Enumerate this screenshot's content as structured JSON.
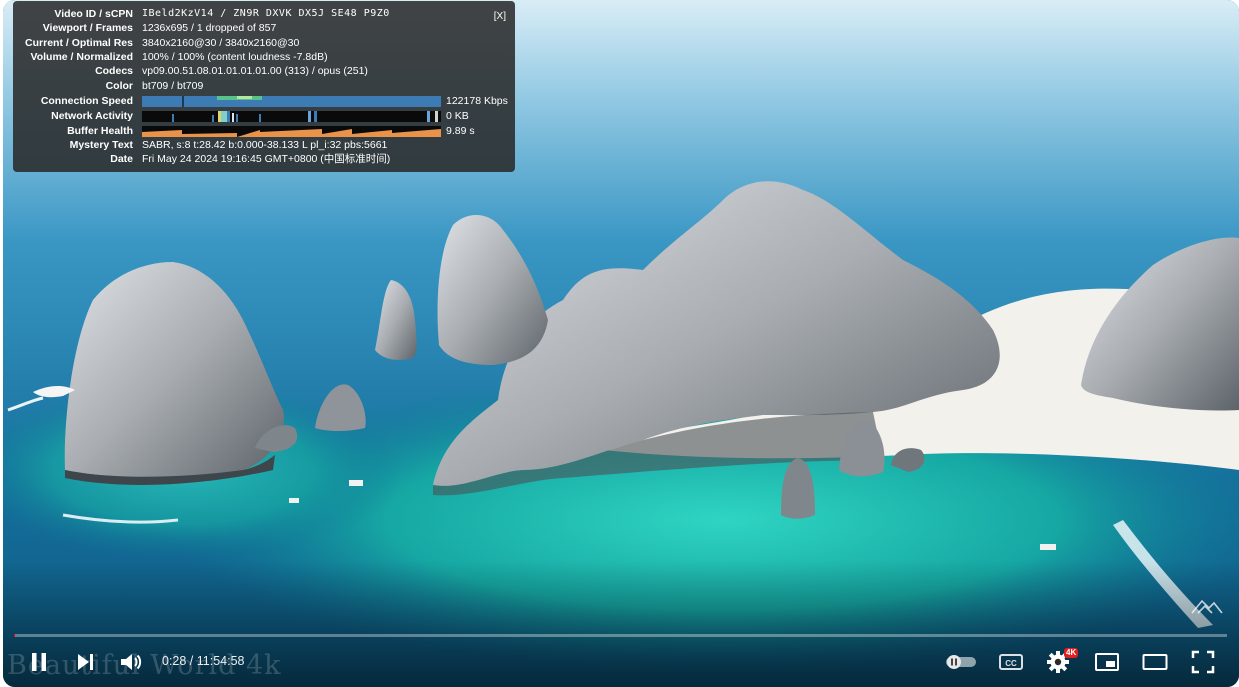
{
  "stats": {
    "close_label": "[X]",
    "rows": [
      {
        "label": "Video ID / sCPN",
        "value": "IBeld2KzV14 / ZN9R DXVK DX5J SE48 P9Z0"
      },
      {
        "label": "Viewport / Frames",
        "value": "1236x695 / 1 dropped of 857"
      },
      {
        "label": "Current / Optimal Res",
        "value": "3840x2160@30 / 3840x2160@30"
      },
      {
        "label": "Volume / Normalized",
        "value": "100% / 100% (content loudness -7.8dB)"
      },
      {
        "label": "Codecs",
        "value": "vp09.00.51.08.01.01.01.01.00 (313) / opus (251)"
      },
      {
        "label": "Color",
        "value": "bt709 / bt709"
      }
    ],
    "connection_speed": {
      "label": "Connection Speed",
      "value": "122178 Kbps"
    },
    "network_activity": {
      "label": "Network Activity",
      "value": "0 KB"
    },
    "buffer_health": {
      "label": "Buffer Health",
      "value": "9.89 s"
    },
    "mystery_text": {
      "label": "Mystery Text",
      "value": "SABR, s:8 t:28.42 b:0.000-38.133 L pl_i:32 pbs:5661"
    },
    "date": {
      "label": "Date",
      "value": "Fri May 24 2024 19:16:45 GMT+0800 (中国标准时间)"
    }
  },
  "controls": {
    "time_display": "0:28 / 11:54:58",
    "played_fraction": 0.00066,
    "loaded_fraction": 0.0009,
    "quality_badge": "4K",
    "icons": [
      "pause-icon",
      "next-icon",
      "volume-icon",
      "autoplay-toggle-icon",
      "subtitles-icon",
      "settings-icon",
      "miniplayer-icon",
      "theater-mode-icon",
      "fullscreen-icon"
    ]
  },
  "watermark": "Beautiful World 4k",
  "colors": {
    "accent": "#ff0000",
    "overlay_bg": "#282828",
    "badge": "#e02020"
  }
}
